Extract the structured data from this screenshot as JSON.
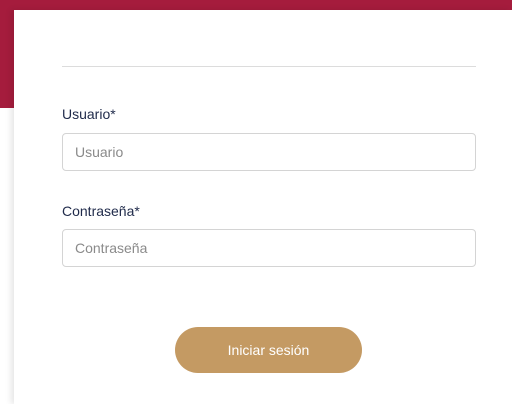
{
  "colors": {
    "brand": "#a51c3d",
    "button": "#c49a63",
    "label_text": "#1f2a4a"
  },
  "form": {
    "username": {
      "label": "Usuario*",
      "placeholder": "Usuario",
      "value": ""
    },
    "password": {
      "label": "Contraseña*",
      "placeholder": "Contraseña",
      "value": ""
    },
    "submit_label": "Iniciar sesión"
  }
}
